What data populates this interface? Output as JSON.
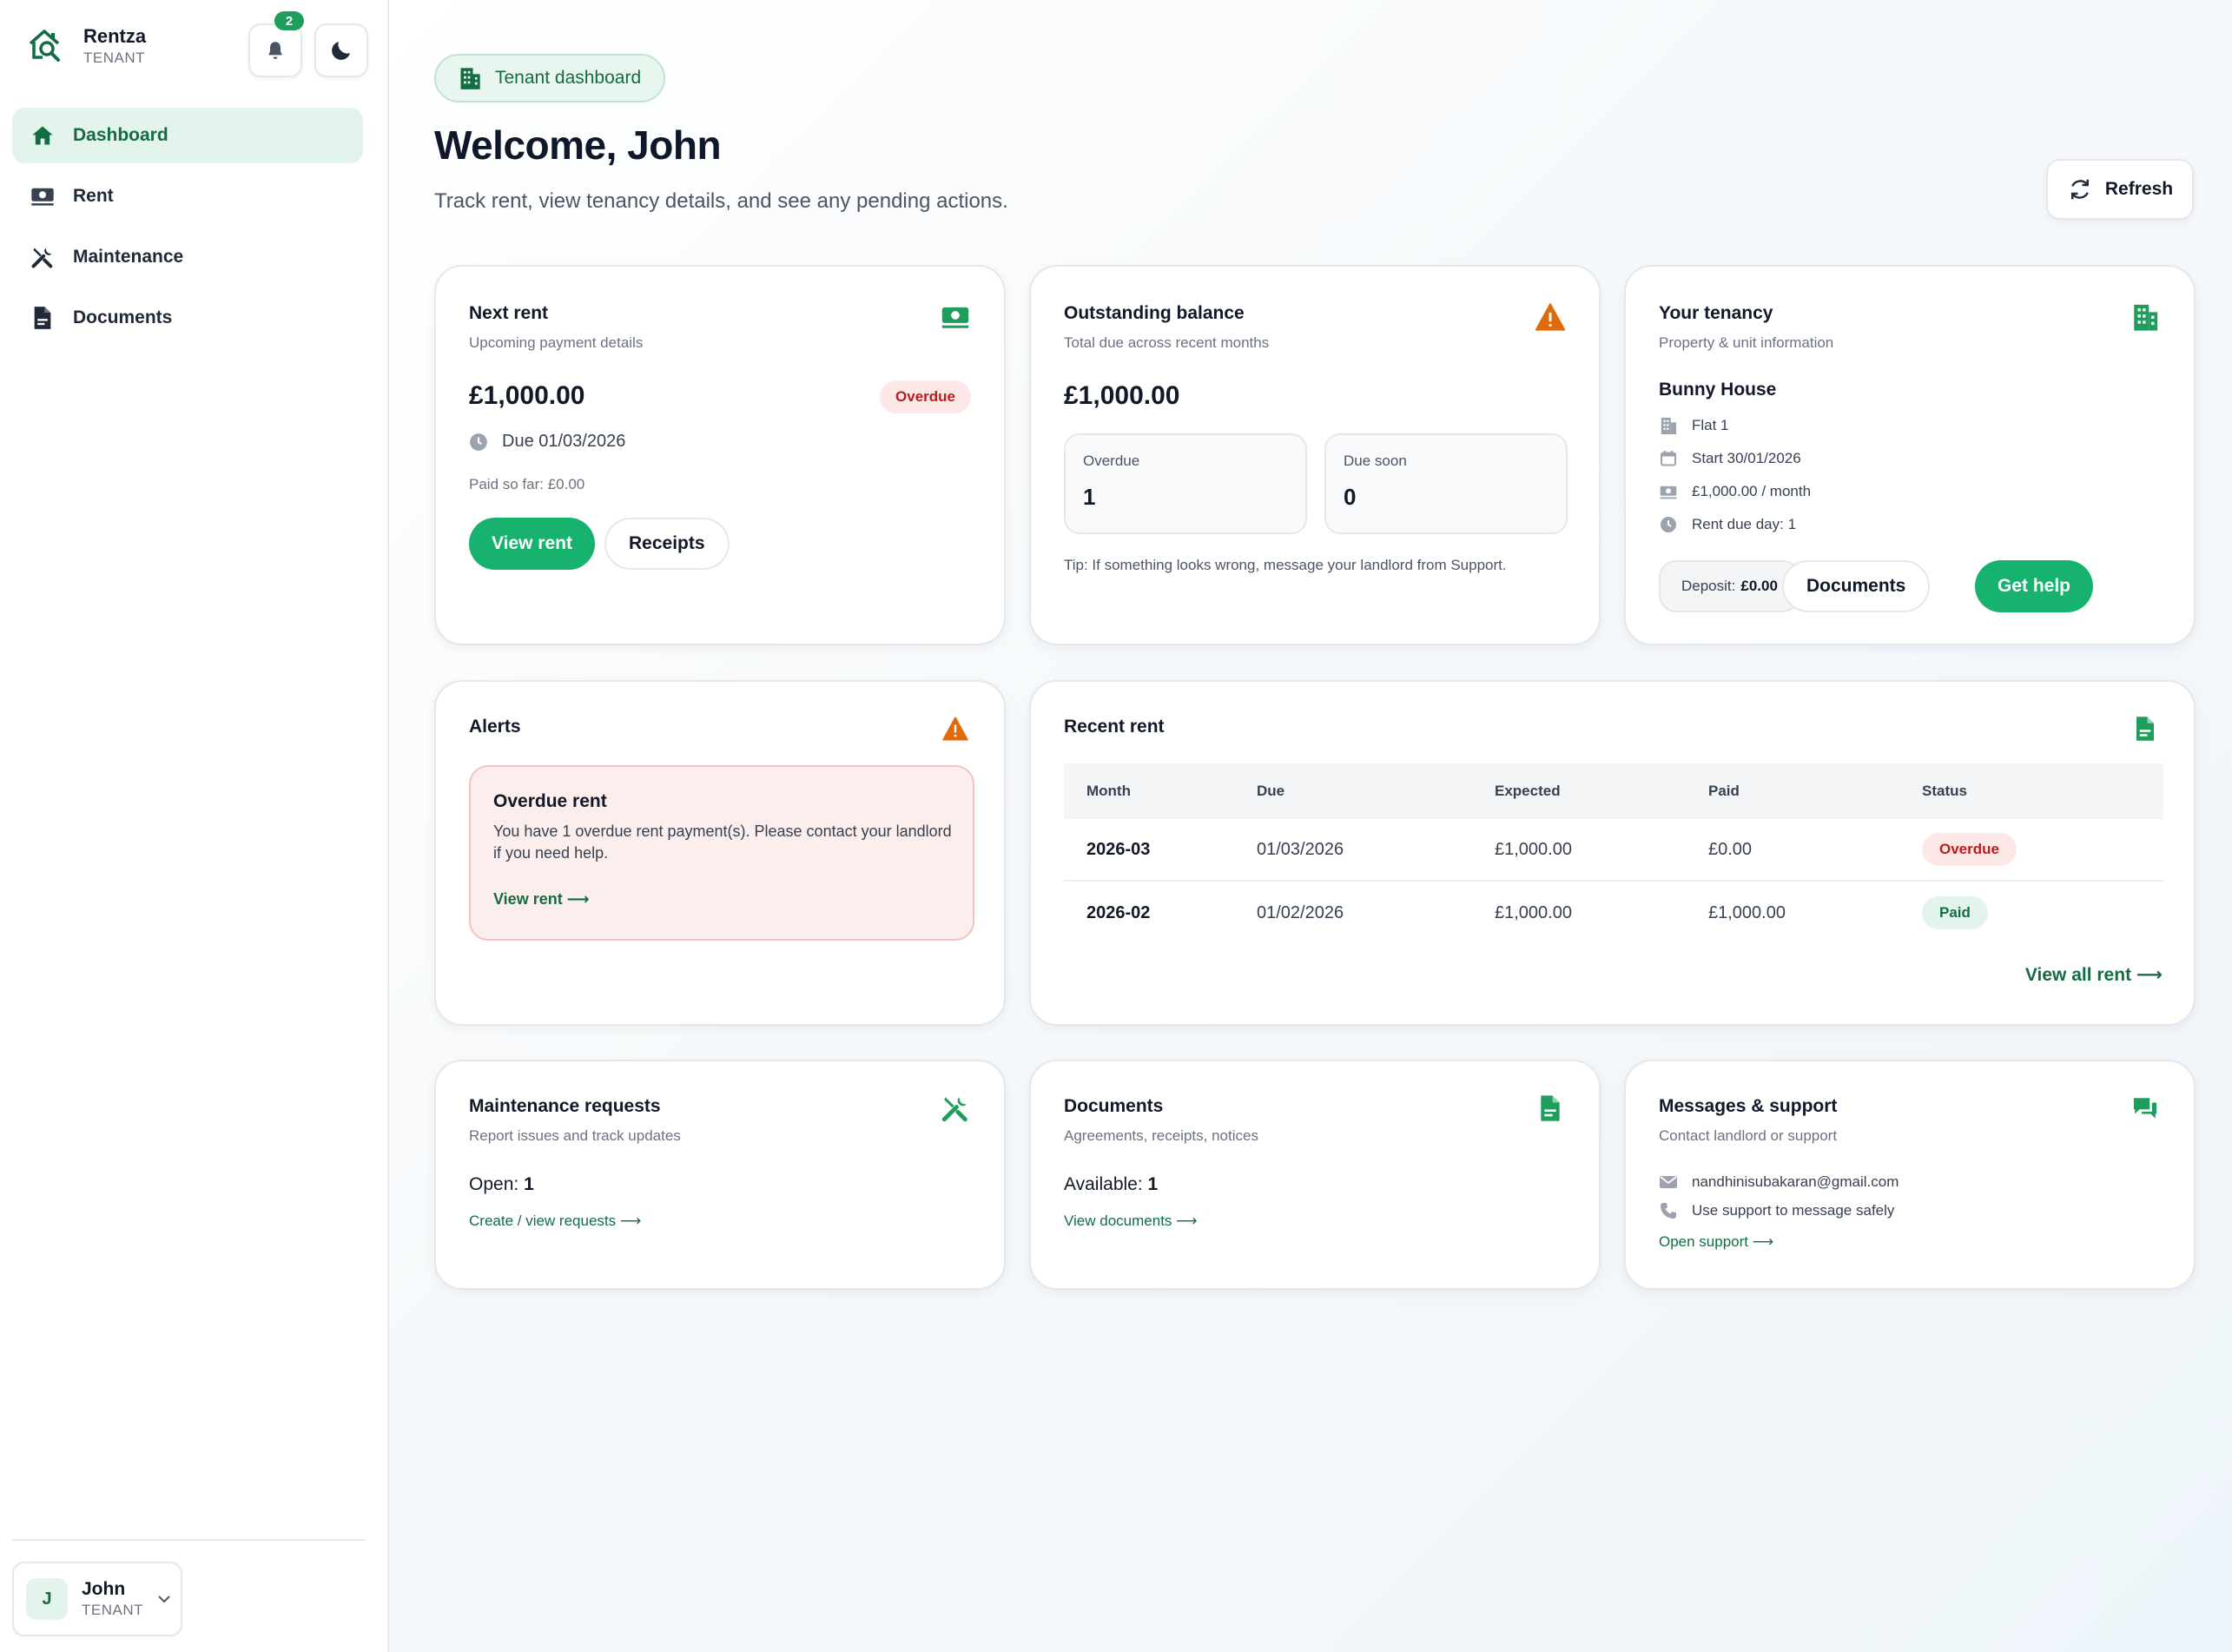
{
  "brand": {
    "name": "Rentza",
    "role": "TENANT"
  },
  "notifications": {
    "count": "2"
  },
  "nav": [
    {
      "label": "Dashboard",
      "icon": "home-icon",
      "active": true
    },
    {
      "label": "Rent",
      "icon": "money-icon",
      "active": false
    },
    {
      "label": "Maintenance",
      "icon": "tools-icon",
      "active": false
    },
    {
      "label": "Documents",
      "icon": "document-icon",
      "active": false
    }
  ],
  "user": {
    "initial": "J",
    "name": "John",
    "role": "TENANT"
  },
  "header": {
    "tag": "Tenant dashboard",
    "welcome": "Welcome, John",
    "subtitle": "Track rent, view tenancy details, and see any pending actions.",
    "refresh": "Refresh"
  },
  "next_rent": {
    "title": "Next rent",
    "subtitle": "Upcoming payment details",
    "amount": "£1,000.00",
    "status": "Overdue",
    "due": "Due 01/03/2026",
    "paid_so_far": "Paid so far: £0.00",
    "view_rent": "View rent",
    "receipts": "Receipts"
  },
  "outstanding": {
    "title": "Outstanding balance",
    "subtitle": "Total due across recent months",
    "amount": "£1,000.00",
    "overdue_label": "Overdue",
    "overdue_value": "1",
    "due_soon_label": "Due soon",
    "due_soon_value": "0",
    "tip": "Tip: If something looks wrong, message your landlord from Support."
  },
  "tenancy": {
    "title": "Your tenancy",
    "subtitle": "Property & unit information",
    "property": "Bunny House",
    "unit": "Flat 1",
    "start": "Start 30/01/2026",
    "rent": "£1,000.00 / month",
    "due_day": "Rent due day: 1",
    "deposit_label": "Deposit:",
    "deposit_value": "£0.00",
    "documents": "Documents",
    "get_help": "Get help"
  },
  "alerts": {
    "title": "Alerts",
    "item_title": "Overdue rent",
    "item_body": "You have 1 overdue rent payment(s). Please contact your landlord if you need help.",
    "item_link": "View rent ⟶"
  },
  "recent_rent": {
    "title": "Recent rent",
    "columns": [
      "Month",
      "Due",
      "Expected",
      "Paid",
      "Status"
    ],
    "rows": [
      {
        "month": "2026-03",
        "due": "01/03/2026",
        "expected": "£1,000.00",
        "paid": "£0.00",
        "status": "Overdue"
      },
      {
        "month": "2026-02",
        "due": "01/02/2026",
        "expected": "£1,000.00",
        "paid": "£1,000.00",
        "status": "Paid"
      }
    ],
    "view_all": "View all rent ⟶"
  },
  "maintenance": {
    "title": "Maintenance requests",
    "subtitle": "Report issues and track updates",
    "count_label": "Open:",
    "count_value": "1",
    "link": "Create / view requests ⟶"
  },
  "documents": {
    "title": "Documents",
    "subtitle": "Agreements, receipts, notices",
    "count_label": "Available:",
    "count_value": "1",
    "link": "View documents ⟶"
  },
  "support": {
    "title": "Messages & support",
    "subtitle": "Contact landlord or support",
    "email": "nandhinisubakaran@gmail.com",
    "phone_note": "Use support to message safely",
    "link": "Open support ⟶"
  },
  "colors": {
    "accent": "#16b26e",
    "accent_dark": "#146c43",
    "danger": "#b91c1c",
    "warning": "#e06b0a"
  }
}
